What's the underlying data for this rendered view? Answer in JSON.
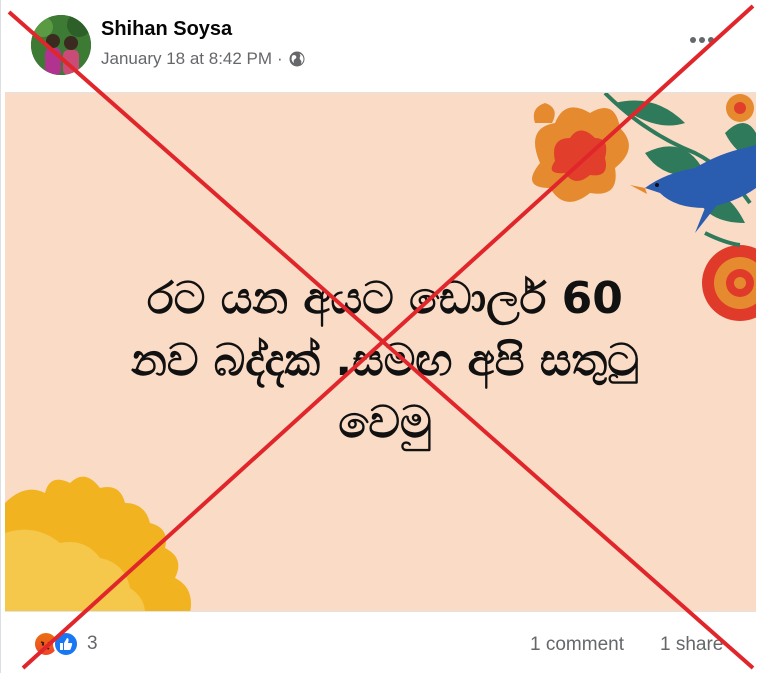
{
  "post": {
    "author": "Shihan Soysa",
    "timestamp": "January 18 at 8:42 PM",
    "separator": "·",
    "privacy_icon": "globe-icon",
    "more_icon": "more-options-icon"
  },
  "image": {
    "headline_lines": [
      "රට යන අයට ඩොලර් 60",
      "නව බද්දක් .සමඟ අපි සතුටු",
      "වෙමු"
    ],
    "background_color": "#fadbc6"
  },
  "footer": {
    "reaction_icons": [
      "angry-reaction-icon",
      "like-reaction-icon"
    ],
    "reaction_count": "3",
    "comments": "1 comment",
    "shares": "1 share"
  },
  "overlay": {
    "cross_color": "#e0262b"
  }
}
